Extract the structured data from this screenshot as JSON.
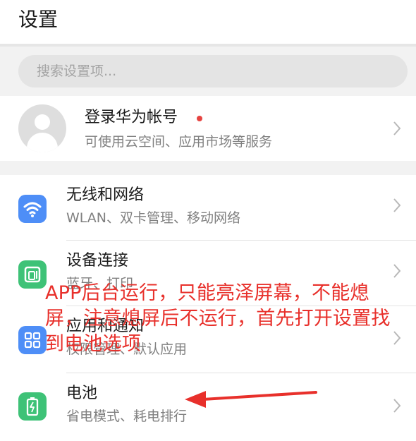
{
  "header": {
    "title": "设置"
  },
  "search": {
    "placeholder": "搜索设置项..."
  },
  "account": {
    "title": "登录华为帐号",
    "subtitle": "可使用云空间、应用市场等服务",
    "dot_color": "#e64340"
  },
  "settings": [
    {
      "title": "无线和网络",
      "subtitle": "WLAN、双卡管理、移动网络",
      "icon": "wifi-icon",
      "color": "#4e8ef7"
    },
    {
      "title": "设备连接",
      "subtitle": "蓝牙、打印",
      "icon": "device-connection-icon",
      "color": "#3ec277"
    },
    {
      "title": "应用和通知",
      "subtitle": "权限管理、默认应用",
      "icon": "apps-grid-icon",
      "color": "#4e8ef7"
    },
    {
      "title": "电池",
      "subtitle": "省电模式、耗电排行",
      "icon": "battery-icon",
      "color": "#3ec277"
    }
  ],
  "annotation": {
    "text": "APP后台运行，只能亮泽屏幕，不能熄屏，注意熄屏后不运行，首先打开设置找到电池选项",
    "color": "#e8302b"
  }
}
